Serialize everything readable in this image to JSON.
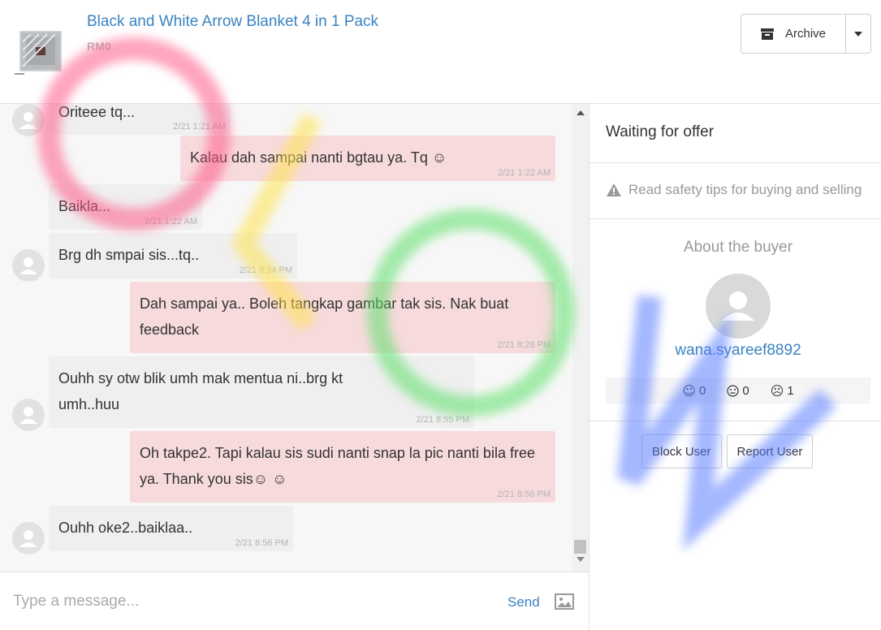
{
  "header": {
    "product_title": "Black and White Arrow Blanket 4 in 1 Pack",
    "product_price": "RM0",
    "archive_label": "Archive"
  },
  "messages": [
    {
      "side": "in",
      "text": "Oriteee tq...",
      "time": "2/21 1:21 AM",
      "avatar": true
    },
    {
      "side": "out",
      "text": "Kalau dah sampai nanti bgtau ya. Tq ☺",
      "time": "2/21 1:22 AM"
    },
    {
      "side": "in",
      "text": "Baikla...",
      "time": "2/21 1:22 AM",
      "avatar": false
    },
    {
      "side": "in",
      "text": "Brg dh smpai sis...tq..",
      "time": "2/21 8:24 PM",
      "avatar": true
    },
    {
      "side": "out",
      "text": "Dah sampai ya.. Boleh tangkap gambar tak sis. Nak buat feedback",
      "time": "2/21 8:28 PM"
    },
    {
      "side": "in",
      "text": "Ouhh sy otw blik umh mak mentua ni..brg kt umh..huu",
      "time": "2/21 8:55 PM",
      "avatar": true
    },
    {
      "side": "out",
      "text": "Oh takpe2. Tapi kalau sis sudi nanti snap la pic nanti bila free ya. Thank you sis☺ ☺",
      "time": "2/21 8:56 PM"
    },
    {
      "side": "in",
      "text": "Ouhh oke2..baiklaa..",
      "time": "2/21 8:56 PM",
      "avatar": true
    }
  ],
  "composer": {
    "placeholder": "Type a message...",
    "send_label": "Send"
  },
  "panel": {
    "status": "Waiting for offer",
    "safety_link": "Read safety tips for buying and selling",
    "about_heading": "About the buyer",
    "username": "wana.syareef8892",
    "ratings": [
      {
        "icon": "smile-icon",
        "face": "☺",
        "count": "0"
      },
      {
        "icon": "neutral-face-icon",
        "face": "😐",
        "count": "0"
      },
      {
        "icon": "frown-icon",
        "face": "☹",
        "count": "1"
      }
    ],
    "block_label": "Block User",
    "report_label": "Report User"
  },
  "colors": {
    "link": "#3a83c2",
    "incoming_bubble": "#efefef",
    "outgoing_bubble": "#f7dadc"
  }
}
